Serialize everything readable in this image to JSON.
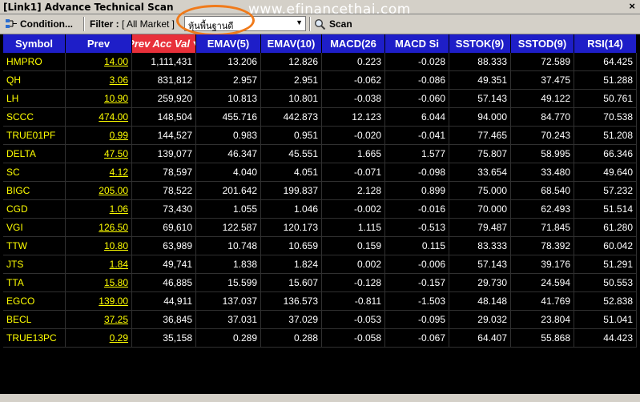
{
  "window": {
    "title": "[Link1] Advance Technical Scan",
    "close_glyph": "×"
  },
  "watermark": "www.efinancethai.com",
  "toolbar": {
    "condition_label": "Condition...",
    "filter_label": "Filter :",
    "filter_value": "[ All Market ]",
    "select_value": "หุ้นพื้นฐานดี",
    "scan_label": "Scan"
  },
  "columns": [
    "Symbol",
    "Prev",
    "Prev Acc Val",
    "EMAV(5)",
    "EMAV(10)",
    "MACD(26",
    "MACD Si",
    "SSTOK(9)",
    "SSTOD(9)",
    "RSI(14)"
  ],
  "sorted_column": "Prev Acc Val",
  "rows": [
    [
      "HMPRO",
      "14.00",
      "1,111,431",
      "13.206",
      "12.826",
      "0.223",
      "-0.028",
      "88.333",
      "72.589",
      "64.425"
    ],
    [
      "QH",
      "3.06",
      "831,812",
      "2.957",
      "2.951",
      "-0.062",
      "-0.086",
      "49.351",
      "37.475",
      "51.288"
    ],
    [
      "LH",
      "10.90",
      "259,920",
      "10.813",
      "10.801",
      "-0.038",
      "-0.060",
      "57.143",
      "49.122",
      "50.761"
    ],
    [
      "SCCC",
      "474.00",
      "148,504",
      "455.716",
      "442.873",
      "12.123",
      "6.044",
      "94.000",
      "84.770",
      "70.538"
    ],
    [
      "TRUE01PF",
      "0.99",
      "144,527",
      "0.983",
      "0.951",
      "-0.020",
      "-0.041",
      "77.465",
      "70.243",
      "51.208"
    ],
    [
      "DELTA",
      "47.50",
      "139,077",
      "46.347",
      "45.551",
      "1.665",
      "1.577",
      "75.807",
      "58.995",
      "66.346"
    ],
    [
      "SC",
      "4.12",
      "78,597",
      "4.040",
      "4.051",
      "-0.071",
      "-0.098",
      "33.654",
      "33.480",
      "49.640"
    ],
    [
      "BIGC",
      "205.00",
      "78,522",
      "201.642",
      "199.837",
      "2.128",
      "0.899",
      "75.000",
      "68.540",
      "57.232"
    ],
    [
      "CGD",
      "1.06",
      "73,430",
      "1.055",
      "1.046",
      "-0.002",
      "-0.016",
      "70.000",
      "62.493",
      "51.514"
    ],
    [
      "VGI",
      "126.50",
      "69,610",
      "122.587",
      "120.173",
      "1.115",
      "-0.513",
      "79.487",
      "71.845",
      "61.280"
    ],
    [
      "TTW",
      "10.80",
      "63,989",
      "10.748",
      "10.659",
      "0.159",
      "0.115",
      "83.333",
      "78.392",
      "60.042"
    ],
    [
      "JTS",
      "1.84",
      "49,741",
      "1.838",
      "1.824",
      "0.002",
      "-0.006",
      "57.143",
      "39.176",
      "51.291"
    ],
    [
      "TTA",
      "15.80",
      "46,885",
      "15.599",
      "15.607",
      "-0.128",
      "-0.157",
      "29.730",
      "24.594",
      "50.553"
    ],
    [
      "EGCO",
      "139.00",
      "44,911",
      "137.037",
      "136.573",
      "-0.811",
      "-1.503",
      "48.148",
      "41.769",
      "52.838"
    ],
    [
      "BECL",
      "37.25",
      "36,845",
      "37.031",
      "37.029",
      "-0.053",
      "-0.095",
      "29.032",
      "23.804",
      "51.041"
    ],
    [
      "TRUE13PC",
      "0.29",
      "35,158",
      "0.289",
      "0.288",
      "-0.058",
      "-0.067",
      "64.407",
      "55.868",
      "44.423"
    ]
  ],
  "colors": {
    "header_bg": "#1e1ec8",
    "sorted_header_bg": "#e8303a",
    "symbol_text": "#ffff00",
    "value_text": "#ffffff",
    "grid_bg": "#000000",
    "highlight_oval": "#f07a1a"
  },
  "icons": {
    "condition": "condition-icon",
    "scan": "magnifier-icon",
    "dropdown": "chevron-down-icon"
  }
}
